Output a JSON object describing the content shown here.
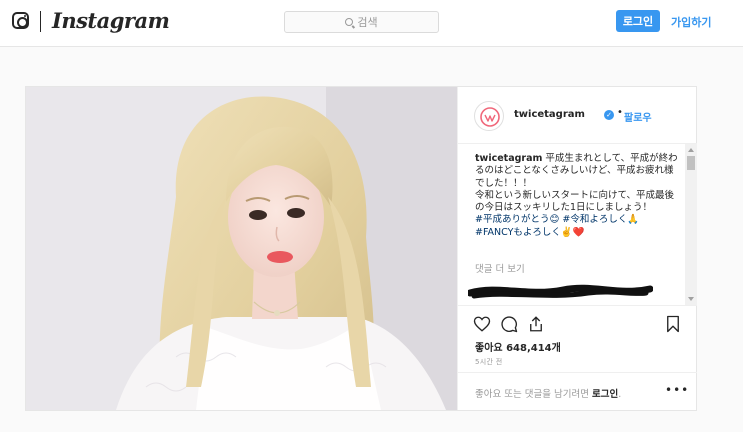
{
  "topnav": {
    "brand": "Instagram",
    "search_placeholder": "검색",
    "login_label": "로그인",
    "signup_label": "가입하기"
  },
  "post": {
    "username": "twicetagram",
    "separator": "•",
    "follow_label": "팔로우",
    "caption_user": "twicetagram",
    "caption_text": " 平成生まれとして、平成が終わるのはどことなくさみしいけど、平成お疲れ様でした！！！\n令和という新しいスタートに向けて、平成最後の今日はスッキリした1日にしましょう！\n",
    "caption_tags_1": "#平成ありがとう😊 #令和よろしく🙏",
    "caption_tags_2": "#FANCYもよろしく✌️❤️",
    "more_comments": "댓글 더 보기",
    "likes_label": "좋아요",
    "likes_count": "648,414개",
    "time_ago": "5시간 전",
    "login_prompt": "좋아요 또는 댓글을 남기려면",
    "login_link": "로그인",
    "login_suffix": ".",
    "more_options": "•••"
  },
  "colors": {
    "accent": "#3897f0",
    "border": "#e6e6e6",
    "muted": "#999999",
    "text": "#262626",
    "heart_red": "#ed4956",
    "twice_pink": "#f0677a"
  },
  "icons": [
    "instagram-camera-icon",
    "search-icon",
    "verified-badge-icon",
    "heart-icon",
    "comment-icon",
    "share-icon",
    "bookmark-icon",
    "more-options-icon"
  ]
}
